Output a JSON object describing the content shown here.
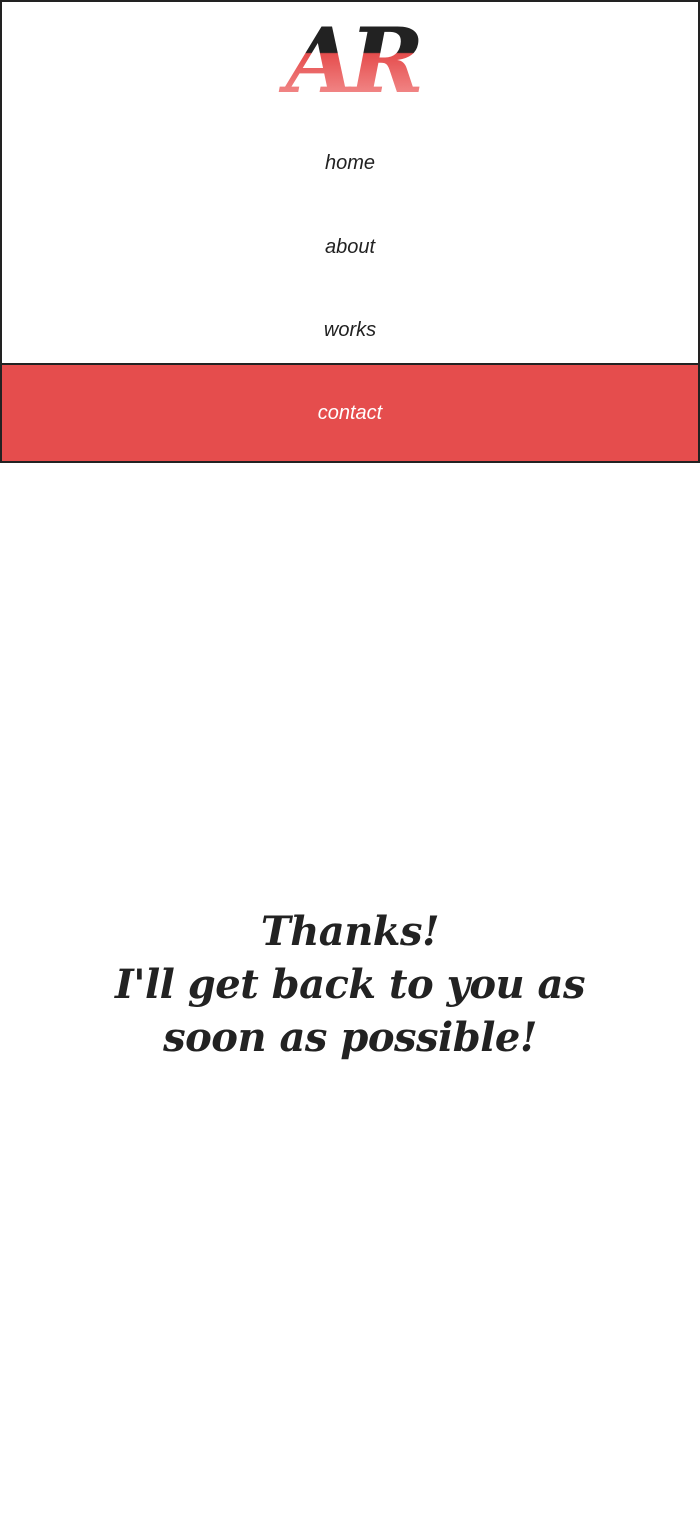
{
  "brand": {
    "logo_text": "AR",
    "colors": {
      "dark": "#222222",
      "accent": "#e54d4d",
      "accent_light": "#f7a3a3"
    }
  },
  "nav": {
    "items": [
      {
        "label": "home"
      },
      {
        "label": "about"
      },
      {
        "label": "works"
      },
      {
        "label": "contact",
        "active": true
      }
    ]
  },
  "main": {
    "heading": "Thanks!",
    "message": "I'll get back to you as soon as possible!"
  }
}
